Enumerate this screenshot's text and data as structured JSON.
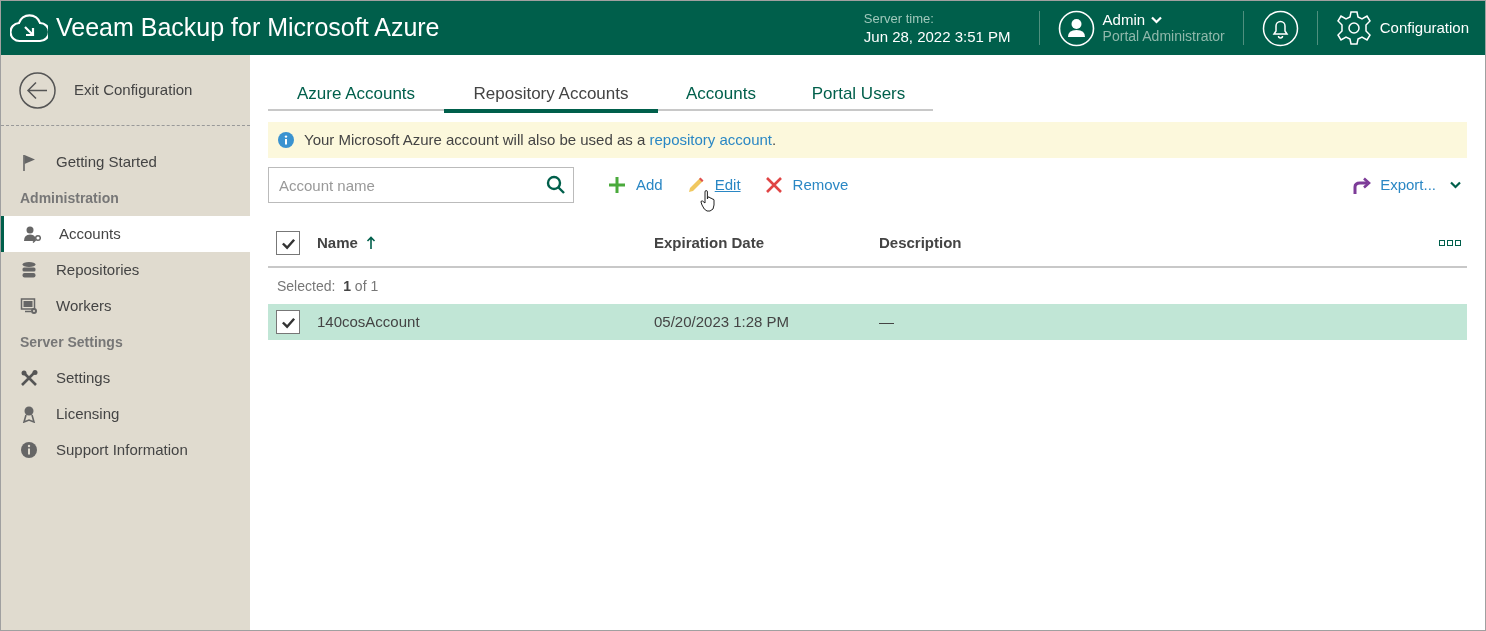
{
  "header": {
    "app_title": "Veeam Backup for Microsoft Azure",
    "server_time_label": "Server time:",
    "server_time": "Jun 28, 2022 3:51 PM",
    "user_name": "Admin",
    "user_role": "Portal Administrator",
    "configuration": "Configuration"
  },
  "sidebar": {
    "exit_label": "Exit Configuration",
    "items": [
      {
        "kind": "item",
        "label": "Getting Started",
        "selected": false
      },
      {
        "kind": "section",
        "label": "Administration"
      },
      {
        "kind": "item",
        "label": "Accounts",
        "selected": true
      },
      {
        "kind": "item",
        "label": "Repositories",
        "selected": false
      },
      {
        "kind": "item",
        "label": "Workers",
        "selected": false
      },
      {
        "kind": "section",
        "label": "Server Settings"
      },
      {
        "kind": "item",
        "label": "Settings",
        "selected": false
      },
      {
        "kind": "item",
        "label": "Licensing",
        "selected": false
      },
      {
        "kind": "item",
        "label": "Support Information",
        "selected": false
      }
    ]
  },
  "tabs": [
    {
      "label": "Azure Accounts",
      "selected": false
    },
    {
      "label": "Repository Accounts",
      "selected": true
    },
    {
      "label": "Accounts",
      "selected": false
    },
    {
      "label": "Portal Users",
      "selected": false
    }
  ],
  "info_banner": {
    "text": "Your Microsoft Azure account will also be used as a ",
    "link": "repository account",
    "text_end": "."
  },
  "search": {
    "placeholder": "Account name"
  },
  "actions": [
    {
      "kind": "add",
      "label": "Add"
    },
    {
      "kind": "edit",
      "label": "Edit"
    },
    {
      "kind": "remove",
      "label": "Remove"
    }
  ],
  "export": {
    "label": "Export..."
  },
  "table": {
    "all_checked": true,
    "columns": [
      {
        "label": "Name",
        "sorted": true
      },
      {
        "label": "Expiration Date",
        "sorted": false
      },
      {
        "label": "Description",
        "sorted": false
      }
    ],
    "selection": "Selected:  **1** of 1",
    "rows": [
      {
        "checked": true,
        "selected": true,
        "cells": [
          "140cosAccount",
          "05/20/2023 1:28 PM",
          "—"
        ]
      }
    ]
  }
}
